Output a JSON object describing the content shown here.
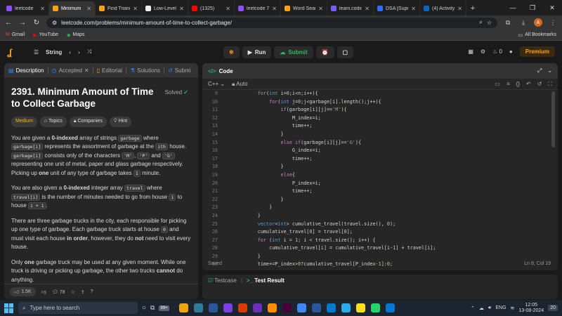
{
  "browser": {
    "tabs": [
      {
        "label": "leetcode",
        "color": "#8a4fff",
        "active": false
      },
      {
        "label": "Minimum",
        "color": "#ffa116",
        "active": true
      },
      {
        "label": "Find Triangle",
        "color": "#ffa116",
        "active": false
      },
      {
        "label": "Low-Level",
        "color": "#f1f1f1",
        "active": false
      },
      {
        "label": "(1325)",
        "color": "#ff0000",
        "active": false
      },
      {
        "label": "leetcode 7",
        "color": "#8a4fff",
        "active": false
      },
      {
        "label": "Word Sear",
        "color": "#ffa116",
        "active": false
      },
      {
        "label": "leam.codin",
        "color": "#7a5cff",
        "active": false
      },
      {
        "label": "DSA [Supe",
        "color": "#2f6bff",
        "active": false
      },
      {
        "label": "(4) Activity",
        "color": "#0a66c2",
        "active": false
      }
    ],
    "url": "leetcode.com/problems/minimum-amount-of-time-to-collect-garbage/",
    "avatar_letter": "A",
    "bookmarks": [
      "Gmail",
      "YouTube",
      "Maps"
    ],
    "all_bookmarks": "All Bookmarks"
  },
  "lc_header": {
    "list_label": "String",
    "run_label": "Run",
    "submit_label": "Submit",
    "streak": "0",
    "premium_label": "Premium"
  },
  "left_panel": {
    "tabs": [
      "Description",
      "Accepted",
      "Editorial",
      "Solutions",
      "Submi"
    ],
    "title": "2391. Minimum Amount of Time to Collect Garbage",
    "solved": "Solved",
    "chips": [
      "Medium",
      "Topics",
      "Companies",
      "Hint"
    ],
    "p1": {
      "a": "You are given a ",
      "b": "0-indexed",
      "c": " array of strings ",
      "code1": "garbage",
      "d": " where ",
      "code2": "garbage[i]",
      "e": " represents the assortment of garbage at the ",
      "code3": "ith",
      "f": " house. ",
      "code4": "garbage[i]",
      "g": " consists only of the characters ",
      "code5": "'M'",
      "h": ", ",
      "code6": "'P'",
      "i": " and ",
      "code7": "'G'",
      "j": " representing one unit of metal, paper and glass garbage respectively. Picking up ",
      "k": "one",
      "l": " unit of any type of garbage takes ",
      "code8": "1",
      "m": " minute."
    },
    "p2": {
      "a": "You are also given a ",
      "b": "0-indexed",
      "c": " integer array ",
      "code1": "travel",
      "d": " where ",
      "code2": "travel[i]",
      "e": " is the number of minutes needed to go from house ",
      "code3": "i",
      "f": " to house ",
      "code4": "i + 1",
      "g": "."
    },
    "p3": {
      "a": "There are three garbage trucks in the city, each responsible for picking up one type of garbage. Each garbage truck starts at house ",
      "code1": "0",
      "b": " and must visit each house ",
      "c": "in order",
      "d": ", however, they do ",
      "e": "not",
      "f": " need to visit every house."
    },
    "p4": {
      "a": "Only ",
      "b": "one",
      "c": " garbage truck may be used at any given moment. While one truck is driving or picking up garbage, the other two trucks ",
      "d": "cannot",
      "e": " do anything."
    },
    "likes": "1.5K",
    "comments": "78"
  },
  "code_panel": {
    "title": "Code",
    "language": "C++",
    "mode": "Auto",
    "saved": "Saved",
    "cursor": "Ln 8, Col 19",
    "lines": [
      {
        "n": "9",
        "text": "        for(int i=0;i<n;i++){"
      },
      {
        "n": "10",
        "text": "            for(int j=0;j<garbage[i].length();j++){"
      },
      {
        "n": "11",
        "text": "                if(garbage[i][j]=='M'){"
      },
      {
        "n": "12",
        "text": "                    M_index=i;"
      },
      {
        "n": "13",
        "text": "                    time++;"
      },
      {
        "n": "14",
        "text": "                }"
      },
      {
        "n": "15",
        "text": "                else if(garbage[i][j]=='G'){"
      },
      {
        "n": "16",
        "text": "                    G_index=i;"
      },
      {
        "n": "17",
        "text": "                    time++;"
      },
      {
        "n": "18",
        "text": "                }"
      },
      {
        "n": "19",
        "text": "                else{"
      },
      {
        "n": "20",
        "text": "                    P_index=i;"
      },
      {
        "n": "21",
        "text": "                    time++;"
      },
      {
        "n": "22",
        "text": "                }"
      },
      {
        "n": "23",
        "text": "            }"
      },
      {
        "n": "24",
        "text": "        }"
      },
      {
        "n": "25",
        "text": "        vector<int> cumulative_travel(travel.size(), 0);"
      },
      {
        "n": "26",
        "text": "        cumulative_travel[0] = travel[0];"
      },
      {
        "n": "27",
        "text": "        for (int i = 1; i < travel.size(); i++) {"
      },
      {
        "n": "28",
        "text": "            cumulative_travel[i] = cumulative_travel[i-1] + travel[i];"
      },
      {
        "n": "29",
        "text": "        }"
      },
      {
        "n": "30",
        "text": "        time+=P_index>0?cumulative_travel[P_index-1]:0;"
      }
    ]
  },
  "test_panel": {
    "testcase_label": "Testcase",
    "result_label": "Test Result"
  },
  "taskbar": {
    "search_placeholder": "Type here to search",
    "weather_badge": "99+",
    "language": "ENG",
    "time": "12:05",
    "date": "13-08-2024",
    "notif": "20",
    "apps": [
      "#f0a30a",
      "#2d7d9a",
      "#2b579a",
      "#7b3fe4",
      "#d83b01",
      "#6b2fba",
      "#ff8c00",
      "#470137",
      "#4285f4",
      "#2b579a",
      "#007acc",
      "#2aabee",
      "#f7df1e",
      "#25d366",
      "#0078d4"
    ]
  }
}
